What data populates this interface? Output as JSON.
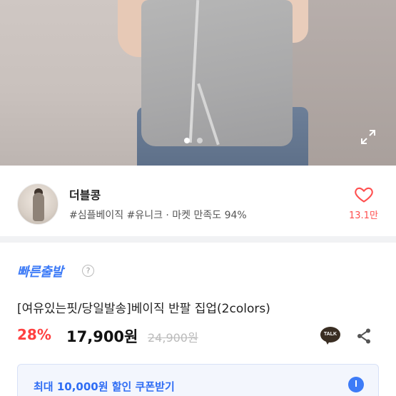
{
  "gallery": {
    "dot_count": 2,
    "active_index": 0
  },
  "shop": {
    "name": "더블콩",
    "meta": "#심플베이직 #유니크 · 마켓 만족도 94%",
    "likes": "13.1만"
  },
  "product": {
    "badge": "빠른출발",
    "help": "?",
    "title": "[여유있는핏/당일발송]베이직 반팔 집업(2colors)",
    "discount": "28%",
    "price": "17,900원",
    "original_price": "24,900원",
    "talk_label": "TALK"
  },
  "coupon": {
    "label": "최대 10,000원 할인 쿠폰받기"
  },
  "colors": {
    "accent": "#3d7bf7",
    "sale": "#ff4040",
    "like": "#ff4f4f"
  }
}
